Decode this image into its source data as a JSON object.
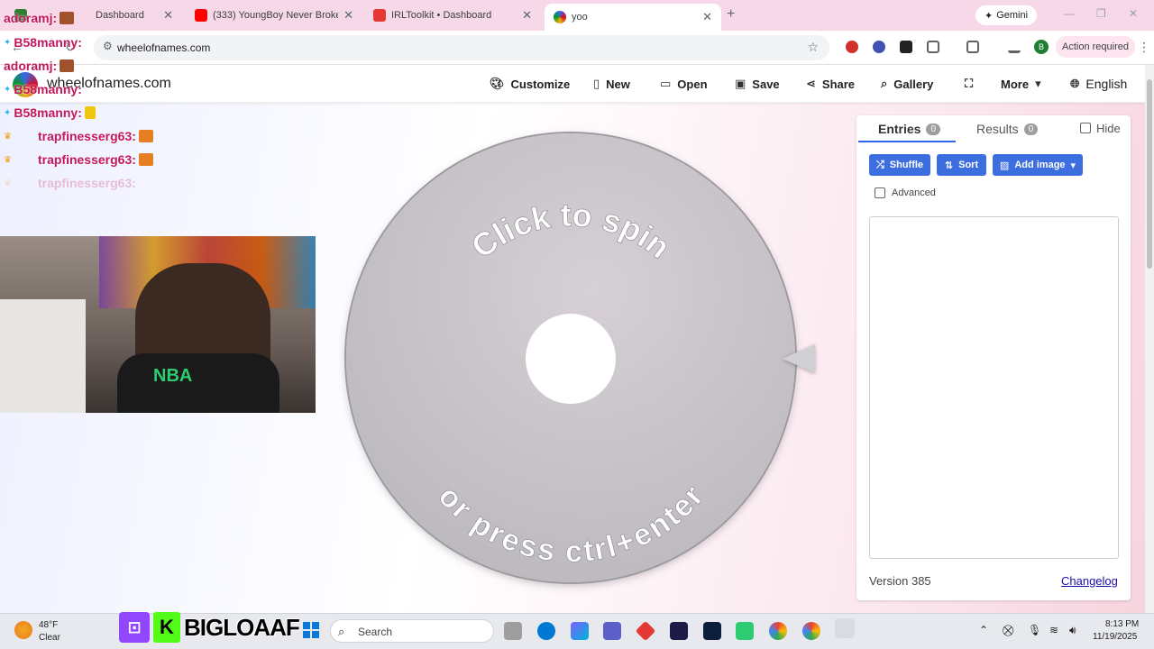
{
  "browser": {
    "tabs": [
      {
        "label": "Dashboard",
        "active": false
      },
      {
        "label": "(333) YoungBoy Never Broke Ag",
        "active": false
      },
      {
        "label": "IRLToolkit • Dashboard",
        "active": false
      },
      {
        "label": "yoo",
        "active": true
      }
    ],
    "new_tab": "+",
    "gemini_label": "Gemini",
    "url": "wheelofnames.com",
    "action_required": "Action required",
    "profile_initial": "B"
  },
  "site": {
    "name": "wheelofnames.com",
    "menu": {
      "customize": "Customize",
      "new": "New",
      "open": "Open",
      "save": "Save",
      "share": "Share",
      "gallery": "Gallery",
      "more": "More",
      "language": "English"
    },
    "wheel": {
      "top_text": "Click to spin",
      "bottom_text": "or press ctrl+enter"
    },
    "panel": {
      "entries_label": "Entries",
      "entries_count": "0",
      "results_label": "Results",
      "results_count": "0",
      "hide_label": "Hide",
      "shuffle": "Shuffle",
      "sort": "Sort",
      "add_image": "Add image",
      "advanced": "Advanced",
      "version": "Version 385",
      "changelog": "Changelog"
    }
  },
  "stream": {
    "chat": [
      {
        "user": "adoramj:"
      },
      {
        "user": "B58manny:"
      },
      {
        "user": "adoramj:"
      },
      {
        "user": "B58manny:"
      },
      {
        "user": "B58manny:"
      },
      {
        "user": "trapfinesserg63:"
      },
      {
        "user": "trapfinesserg63:"
      },
      {
        "user": "trapfinesserg63:"
      }
    ],
    "shirt_text": "NBA",
    "banner_name": "BIGLOAAF"
  },
  "taskbar": {
    "temperature": "48°F",
    "weather": "Clear",
    "search_placeholder": "Search",
    "time": "8:13 PM",
    "date": "11/19/2025"
  },
  "colors": {
    "accent_blue": "#3d6ee0",
    "chat_name": "#c2185b",
    "tab_bar": "#f7d8e8"
  }
}
